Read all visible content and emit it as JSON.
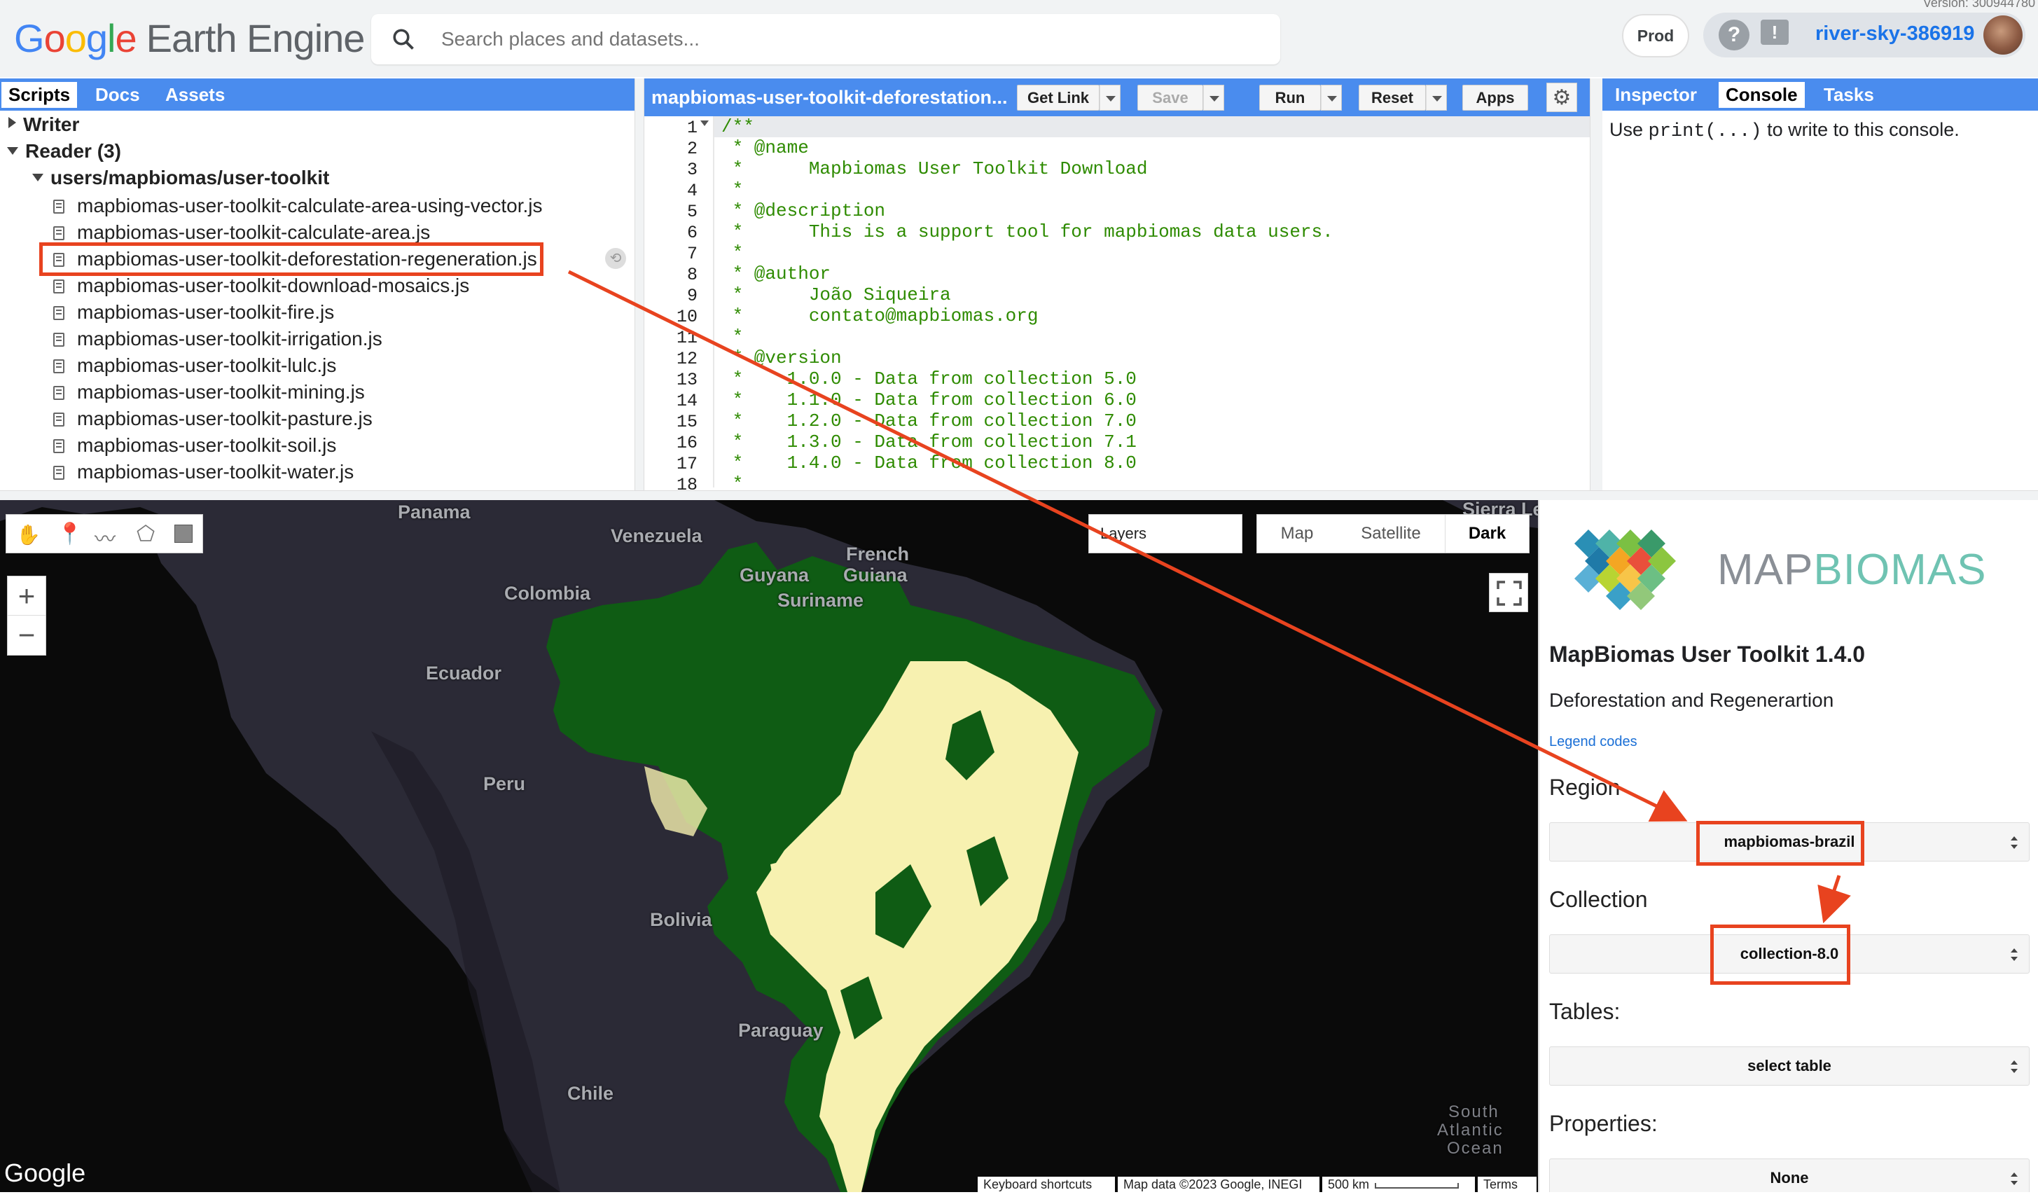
{
  "app": {
    "logo_google": "Google",
    "logo_product": "Earth Engine",
    "search_placeholder": "Search places and datasets...",
    "env_button": "Prod",
    "account_name": "river-sky-386919",
    "version_text": "Version: 300944780"
  },
  "left_panel": {
    "tabs": [
      "Scripts",
      "Docs",
      "Assets"
    ],
    "active_tab": "Scripts",
    "tree": {
      "writer_label": "Writer",
      "reader_label": "Reader (3)",
      "repo_label": "users/mapbiomas/user-toolkit",
      "files": [
        "mapbiomas-user-toolkit-calculate-area-using-vector.js",
        "mapbiomas-user-toolkit-calculate-area.js",
        "mapbiomas-user-toolkit-deforestation-regeneration.js",
        "mapbiomas-user-toolkit-download-mosaics.js",
        "mapbiomas-user-toolkit-fire.js",
        "mapbiomas-user-toolkit-irrigation.js",
        "mapbiomas-user-toolkit-lulc.js",
        "mapbiomas-user-toolkit-mining.js",
        "mapbiomas-user-toolkit-pasture.js",
        "mapbiomas-user-toolkit-soil.js",
        "mapbiomas-user-toolkit-water.js"
      ],
      "selected_file_index": 2
    }
  },
  "editor": {
    "title": "mapbiomas-user-toolkit-deforestation...",
    "buttons": {
      "get_link": "Get Link",
      "save": "Save",
      "run": "Run",
      "reset": "Reset",
      "apps": "Apps"
    },
    "line_numbers": [
      "1",
      "2",
      "3",
      "4",
      "5",
      "6",
      "7",
      "8",
      "9",
      "10",
      "11",
      "12",
      "13",
      "14",
      "15",
      "16",
      "17",
      "18"
    ],
    "lines": [
      "/**",
      " * @name",
      " *      Mapbiomas User Toolkit Download",
      " *",
      " * @description",
      " *      This is a support tool for mapbiomas data users.",
      " *",
      " * @author",
      " *      João Siqueira",
      " *      contato@mapbiomas.org",
      " *",
      " * @version",
      " *    1.0.0 - Data from collection 5.0",
      " *    1.1.0 - Data from collection 6.0",
      " *    1.2.0 - Data from collection 7.0",
      " *    1.3.0 - Data from collection 7.1",
      " *    1.4.0 - Data from collection 8.0",
      " *"
    ]
  },
  "right_panel": {
    "tabs": [
      "Inspector",
      "Console",
      "Tasks"
    ],
    "active_tab": "Console",
    "console_prefix": "Use",
    "console_code": "print(...)",
    "console_suffix": "to write to this console."
  },
  "map": {
    "layers_label": "Layers",
    "type_buttons": [
      "Map",
      "Satellite",
      "Dark"
    ],
    "active_type": "Dark",
    "zoom_in": "+",
    "zoom_out": "−",
    "labels": {
      "panama": "Panama",
      "venezuela": "Venezuela",
      "french_guiana_1": "French",
      "french_guiana_2": "Guiana",
      "guyana": "Guyana",
      "suriname": "Suriname",
      "colombia": "Colombia",
      "ecuador": "Ecuador",
      "peru": "Peru",
      "bolivia": "Bolivia",
      "paraguay": "Paraguay",
      "chile": "Chile",
      "sierra": "Sierra Le",
      "ocean_1": "South",
      "ocean_2": "Atlantic",
      "ocean_3": "Ocean"
    },
    "google_mark": "Google",
    "footer": {
      "shortcuts": "Keyboard shortcuts",
      "data": "Map data ©2023 Google, INEGI",
      "scale": "500 km",
      "terms": "Terms"
    },
    "colors": {
      "forest": "#0f5c14",
      "deforestation": "#f7f1b0",
      "land": "#2b2a36",
      "water": "#0a0a0a"
    }
  },
  "side_panel": {
    "brand": "MAPBIOMAS",
    "brand_map": "MAP",
    "brand_biomas": "BIOMAS",
    "title": "MapBiomas User Toolkit 1.4.0",
    "subtitle": "Deforestation and Regenerartion",
    "legend_link": "Legend codes",
    "region_label": "Region",
    "region_value": "mapbiomas-brazil",
    "collection_label": "Collection",
    "collection_value": "collection-8.0",
    "tables_label": "Tables:",
    "tables_value": "select table",
    "properties_label": "Properties:",
    "properties_value": "None"
  },
  "annotation_color": "#e8431f"
}
